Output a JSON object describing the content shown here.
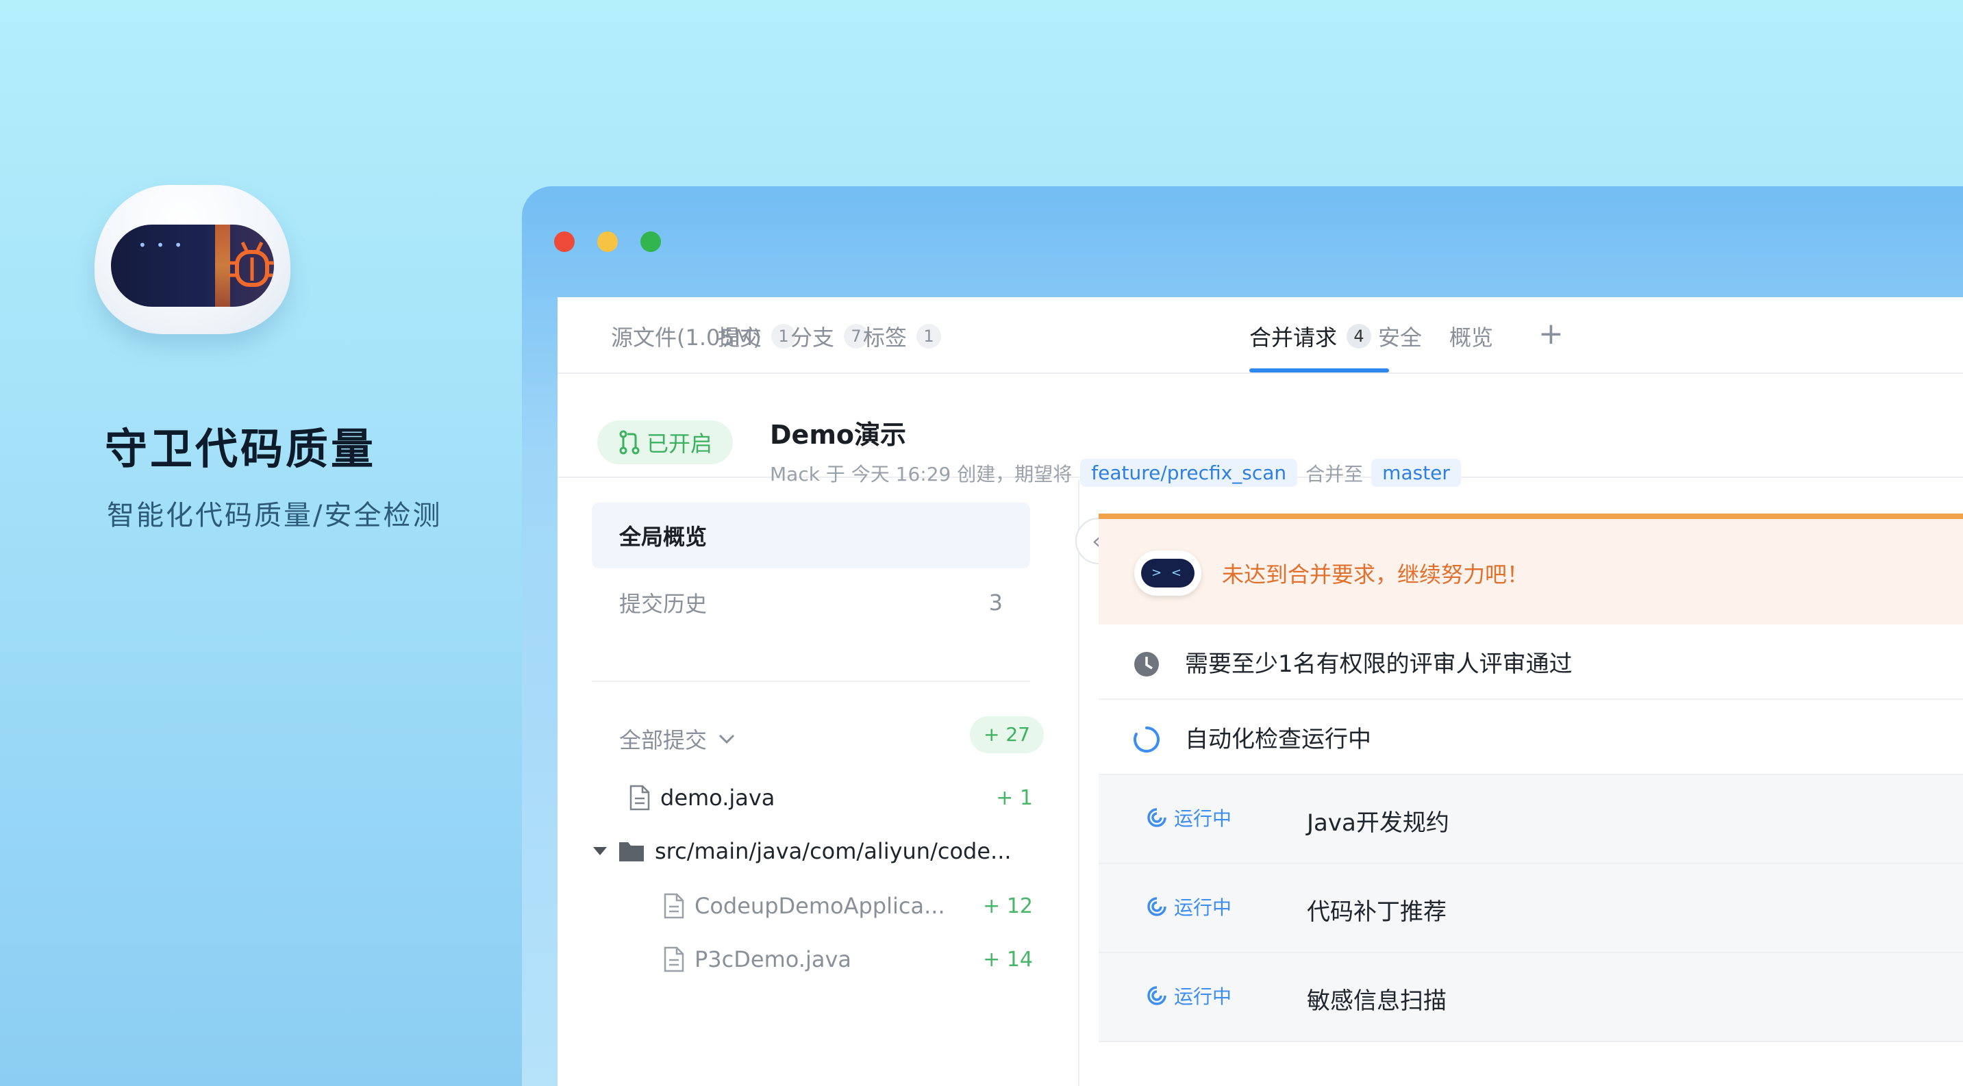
{
  "promo": {
    "title": "守卫代码质量",
    "subtitle": "智能化代码质量/安全检测"
  },
  "tabs": [
    {
      "label": "源文件(1.05M)",
      "count": ""
    },
    {
      "label": "提交",
      "count": "1"
    },
    {
      "label": "分支",
      "count": "7"
    },
    {
      "label": "标签",
      "count": "1"
    },
    {
      "label": "合并请求",
      "count": "4"
    },
    {
      "label": "安全",
      "count": ""
    },
    {
      "label": "概览",
      "count": ""
    }
  ],
  "tab_add": "+",
  "merge_request": {
    "status": "已开启",
    "title": "Demo演示",
    "meta_prefix": "Mack 于 今天 16:29 创建，期望将",
    "source_branch": "feature/precfix_scan",
    "merge_to": "合并至",
    "target_branch": "master"
  },
  "sidebar": {
    "overview": "全局概览",
    "history": "提交历史",
    "history_count": "3",
    "all_commits": "全部提交",
    "all_commits_badge": "+ 27",
    "collapse": "«",
    "files": [
      {
        "name": "demo.java",
        "add": "+ 1"
      },
      {
        "name": "src/main/java/com/aliyun/code...",
        "add": ""
      },
      {
        "name": "CodeupDemoApplica...",
        "add": "+ 12"
      },
      {
        "name": "P3cDemo.java",
        "add": "+ 14"
      }
    ]
  },
  "content": {
    "warning": "未达到合并要求，继续努力吧！",
    "robot_face": "> <",
    "requirements": [
      "需要至少1名有权限的评审人评审通过",
      "自动化检查运行中"
    ],
    "jobs": [
      {
        "status": "运行中",
        "name": "Java开发规约"
      },
      {
        "status": "运行中",
        "name": "代码补丁推荐"
      },
      {
        "status": "运行中",
        "name": "敏感信息扫描"
      }
    ]
  },
  "colors": {
    "accent": "#2f87f0",
    "success": "#3cb160",
    "warning": "#e0702c"
  }
}
